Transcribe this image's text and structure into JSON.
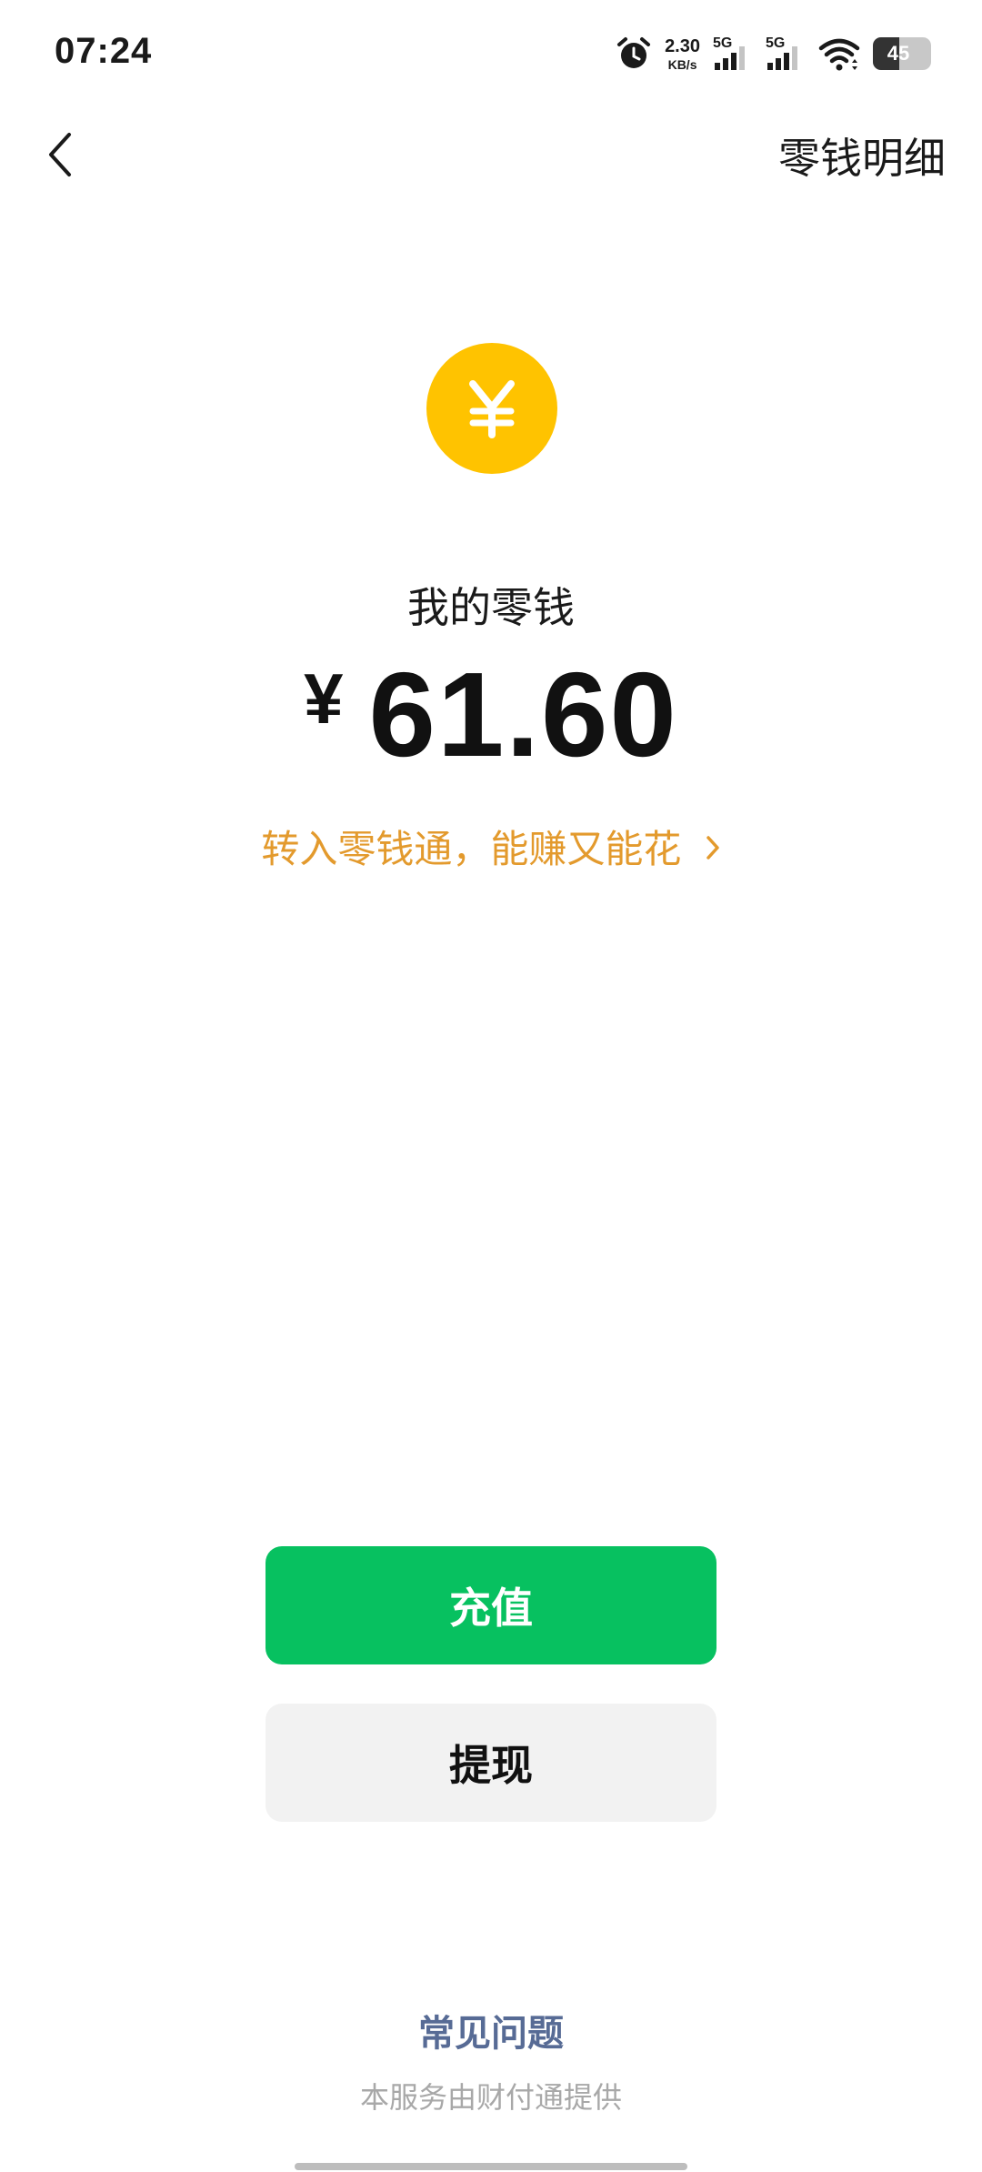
{
  "status_bar": {
    "time": "07:24",
    "net_speed_value": "2.30",
    "net_speed_unit": "KB/s",
    "sim1_label": "5G",
    "sim2_label": "5G",
    "battery_level": "45",
    "battery_percent": 45
  },
  "nav": {
    "detail_label": "零钱明细"
  },
  "wallet": {
    "title": "我的零钱",
    "currency_symbol": "¥",
    "balance": "61.60",
    "promo_text": "转入零钱通，能赚又能花"
  },
  "actions": {
    "recharge_label": "充值",
    "withdraw_label": "提现"
  },
  "footer": {
    "faq_label": "常见问题",
    "provider_text": "本服务由财付通提供"
  },
  "icons": {
    "back": "chevron-left-icon",
    "coin": "yuan-coin-icon",
    "promo_arrow": "chevron-right-icon",
    "alarm": "alarm-clock-icon",
    "wifi": "wifi-icon"
  },
  "colors": {
    "primary_green": "#07C160",
    "coin_yellow": "#FFC300",
    "promo_orange": "#E39A2D",
    "link_blue": "#576B95",
    "secondary_button": "#F2F2F2"
  }
}
